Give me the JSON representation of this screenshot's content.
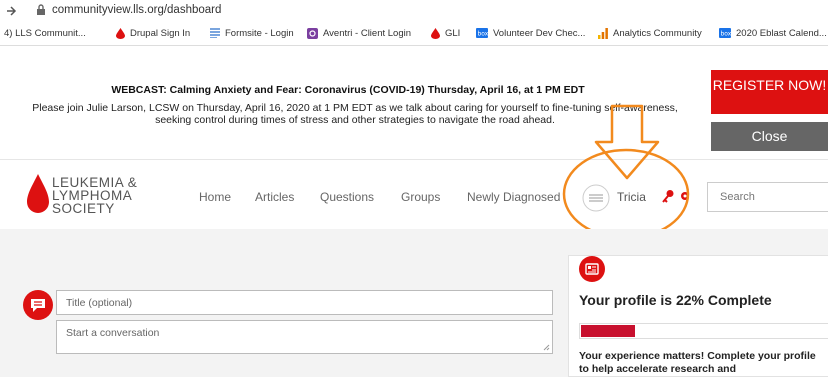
{
  "browser": {
    "url": "communityview.lls.org/dashboard",
    "bookmarks": [
      {
        "label": "4) LLS Communit...",
        "icon": "none"
      },
      {
        "label": "Drupal Sign In",
        "icon": "drop-icon"
      },
      {
        "label": "Formsite - Login",
        "icon": "list-icon"
      },
      {
        "label": "Aventri - Client Login",
        "icon": "aventri-icon"
      },
      {
        "label": "GLI",
        "icon": "drop-icon"
      },
      {
        "label": "Volunteer Dev Chec...",
        "icon": "box-icon"
      },
      {
        "label": "Analytics Community",
        "icon": "bars-icon"
      },
      {
        "label": "2020 Eblast Calend...",
        "icon": "box-icon"
      }
    ]
  },
  "banner": {
    "title": "WEBCAST: Calming Anxiety and Fear: Coronavirus (COVID-19) Thursday, April 16, at 1 PM EDT",
    "body": "Please join Julie Larson, LCSW on Thursday, April 16, 2020 at 1 PM EDT as we talk about caring for yourself to fine-tuning self-awareness, seeking control during times of stress and other strategies to navigate the road ahead.",
    "register_label": "REGISTER NOW!",
    "close_label": "Close"
  },
  "header": {
    "logo_line1": "LEUKEMIA &",
    "logo_line2": "LYMPHOMA",
    "logo_line3": "SOCIETY",
    "nav": [
      "Home",
      "Articles",
      "Questions",
      "Groups",
      "Newly Diagnosed"
    ],
    "user_name": "Tricia",
    "search_placeholder": "Search"
  },
  "composer": {
    "title_placeholder": "Title (optional)",
    "message_placeholder": "Start a conversation"
  },
  "profile": {
    "title": "Your profile is 22% Complete",
    "percent": 22,
    "description": "Your experience matters! Complete your profile to help accelerate research and"
  },
  "colors": {
    "brand_red": "#d11",
    "annotation_orange": "#f28a1e"
  }
}
